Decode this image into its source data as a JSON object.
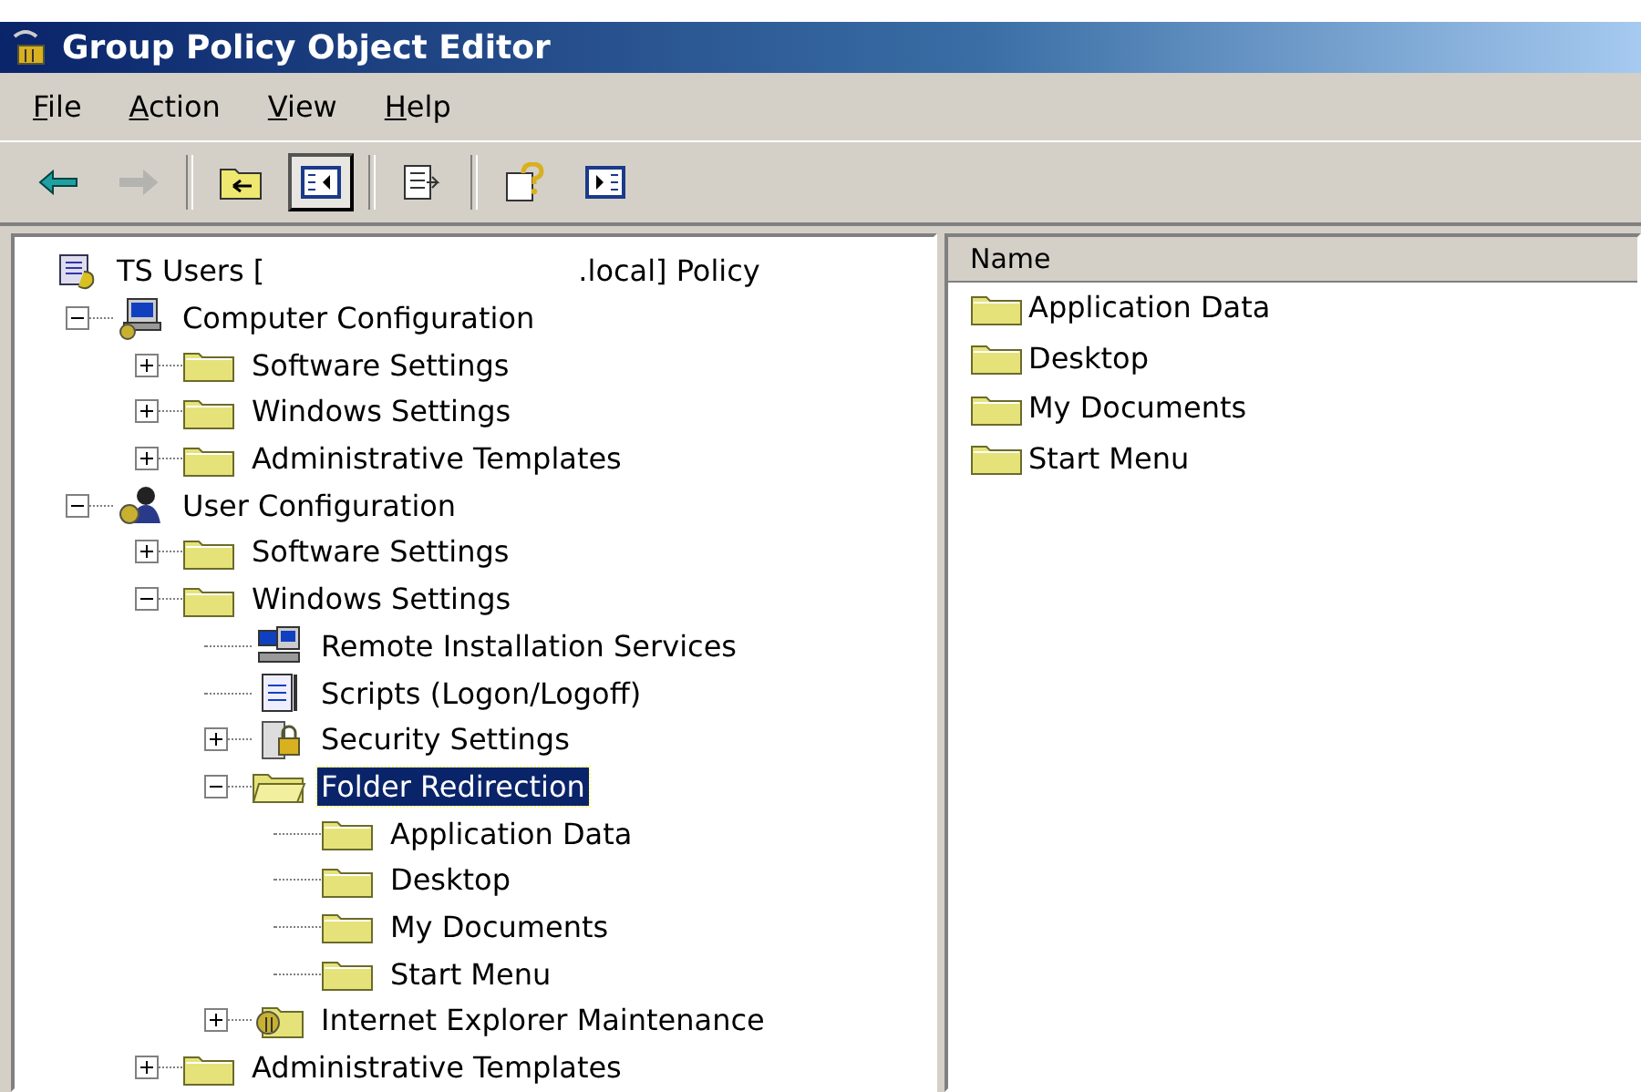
{
  "window": {
    "title": "Group Policy Object Editor"
  },
  "menu": [
    "File",
    "Action",
    "View",
    "Help"
  ],
  "toolbar": [
    {
      "kind": "back",
      "disabled": false,
      "pressed": false
    },
    {
      "kind": "forward",
      "disabled": true,
      "pressed": false
    },
    {
      "kind": "separator"
    },
    {
      "kind": "up",
      "disabled": false,
      "pressed": false
    },
    {
      "kind": "tree",
      "disabled": false,
      "pressed": true
    },
    {
      "kind": "separator"
    },
    {
      "kind": "export",
      "disabled": false,
      "pressed": false
    },
    {
      "kind": "separator"
    },
    {
      "kind": "help",
      "disabled": false,
      "pressed": false
    },
    {
      "kind": "pane",
      "disabled": false,
      "pressed": false
    }
  ],
  "tree": [
    {
      "label": "TS Users [",
      "label_suffix": ".local] Policy",
      "kind": "policy",
      "selected": false,
      "children": [
        {
          "label": "Computer Configuration",
          "kind": "computer",
          "expanded": true,
          "selected": false,
          "children": [
            {
              "label": "Software Settings",
              "kind": "folder",
              "expanded": false,
              "selected": false
            },
            {
              "label": "Windows Settings",
              "kind": "folder",
              "expanded": false,
              "selected": false
            },
            {
              "label": "Administrative Templates",
              "kind": "folder",
              "expanded": false,
              "selected": false
            }
          ]
        },
        {
          "label": "User Configuration",
          "kind": "user",
          "expanded": true,
          "selected": false,
          "children": [
            {
              "label": "Software Settings",
              "kind": "folder",
              "expanded": false,
              "selected": false
            },
            {
              "label": "Windows Settings",
              "kind": "folder",
              "expanded": true,
              "selected": false,
              "children": [
                {
                  "label": "Remote Installation Services",
                  "kind": "network",
                  "selected": false
                },
                {
                  "label": "Scripts (Logon/Logoff)",
                  "kind": "script",
                  "selected": false
                },
                {
                  "label": "Security Settings",
                  "kind": "security",
                  "expanded": false,
                  "selected": false
                },
                {
                  "label": "Folder Redirection",
                  "kind": "folder-open",
                  "expanded": true,
                  "selected": true,
                  "children": [
                    {
                      "label": "Application Data",
                      "kind": "folder",
                      "selected": false
                    },
                    {
                      "label": "Desktop",
                      "kind": "folder",
                      "selected": false
                    },
                    {
                      "label": "My Documents",
                      "kind": "folder",
                      "selected": false
                    },
                    {
                      "label": "Start Menu",
                      "kind": "folder",
                      "selected": false
                    }
                  ]
                },
                {
                  "label": "Internet Explorer Maintenance",
                  "kind": "ie",
                  "expanded": false,
                  "selected": false
                }
              ]
            },
            {
              "label": "Administrative Templates",
              "kind": "folder",
              "expanded": false,
              "selected": false
            }
          ]
        }
      ]
    }
  ],
  "list": {
    "columns": [
      "Name"
    ],
    "items": [
      "Application Data",
      "Desktop",
      "My Documents",
      "Start Menu"
    ]
  }
}
